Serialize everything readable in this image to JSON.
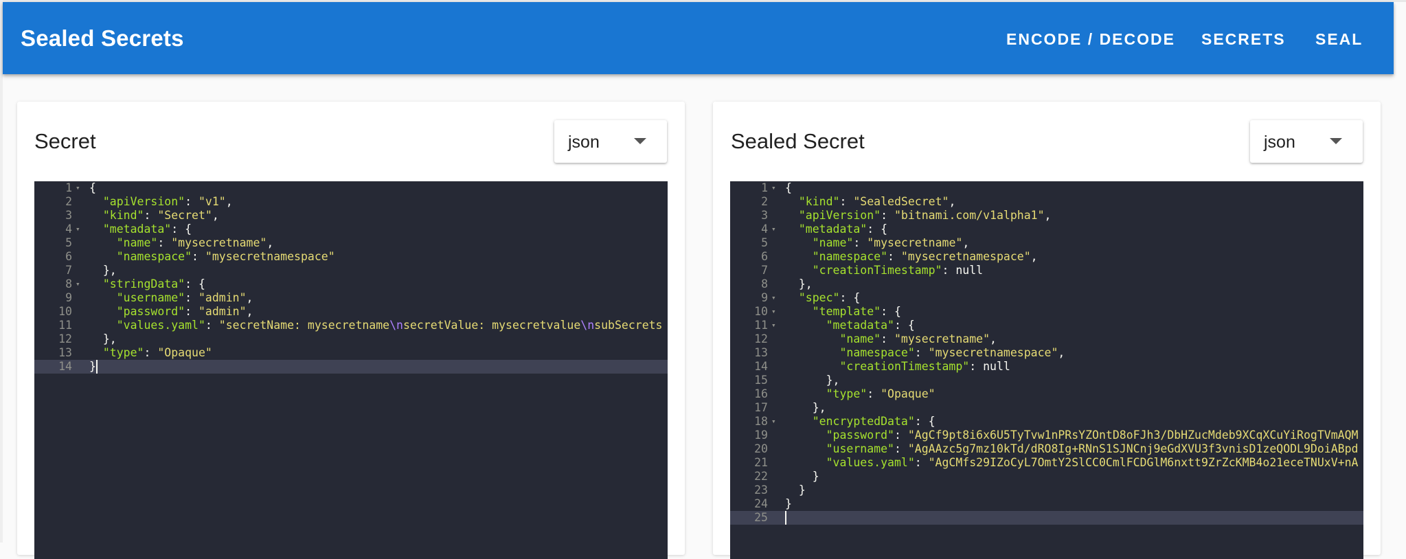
{
  "app": {
    "title": "Sealed Secrets"
  },
  "nav": [
    {
      "label": "ENCODE / DECODE"
    },
    {
      "label": "SECRETS"
    },
    {
      "label": "SEAL"
    }
  ],
  "left_panel": {
    "title": "Secret",
    "format": "json",
    "lines": [
      {
        "n": "1",
        "t": "{"
      },
      {
        "n": "2",
        "t": "  \"apiVersion\": \"v1\","
      },
      {
        "n": "3",
        "t": "  \"kind\": \"Secret\","
      },
      {
        "n": "4",
        "t": "  \"metadata\": {"
      },
      {
        "n": "5",
        "t": "    \"name\": \"mysecretname\","
      },
      {
        "n": "6",
        "t": "    \"namespace\": \"mysecretnamespace\""
      },
      {
        "n": "7",
        "t": "  },"
      },
      {
        "n": "8",
        "t": "  \"stringData\": {"
      },
      {
        "n": "9",
        "t": "    \"username\": \"admin\","
      },
      {
        "n": "10",
        "t": "    \"password\": \"admin\","
      },
      {
        "n": "11",
        "t": "    \"values.yaml\": \"secretName: mysecretname\\nsecretValue: mysecretvalue\\nsubSecrets"
      },
      {
        "n": "12",
        "t": "  },"
      },
      {
        "n": "13",
        "t": "  \"type\": \"Opaque\""
      },
      {
        "n": "14",
        "t": "}"
      }
    ]
  },
  "right_panel": {
    "title": "Sealed Secret",
    "format": "json",
    "lines": [
      {
        "n": "1",
        "t": "{"
      },
      {
        "n": "2",
        "t": "  \"kind\": \"SealedSecret\","
      },
      {
        "n": "3",
        "t": "  \"apiVersion\": \"bitnami.com/v1alpha1\","
      },
      {
        "n": "4",
        "t": "  \"metadata\": {"
      },
      {
        "n": "5",
        "t": "    \"name\": \"mysecretname\","
      },
      {
        "n": "6",
        "t": "    \"namespace\": \"mysecretnamespace\","
      },
      {
        "n": "7",
        "t": "    \"creationTimestamp\": null"
      },
      {
        "n": "8",
        "t": "  },"
      },
      {
        "n": "9",
        "t": "  \"spec\": {"
      },
      {
        "n": "10",
        "t": "    \"template\": {"
      },
      {
        "n": "11",
        "t": "      \"metadata\": {"
      },
      {
        "n": "12",
        "t": "        \"name\": \"mysecretname\","
      },
      {
        "n": "13",
        "t": "        \"namespace\": \"mysecretnamespace\","
      },
      {
        "n": "14",
        "t": "        \"creationTimestamp\": null"
      },
      {
        "n": "15",
        "t": "      },"
      },
      {
        "n": "16",
        "t": "      \"type\": \"Opaque\""
      },
      {
        "n": "17",
        "t": "    },"
      },
      {
        "n": "18",
        "t": "    \"encryptedData\": {"
      },
      {
        "n": "19",
        "t": "      \"password\": \"AgCf9pt8i6x6U5TyTvw1nPRsYZOntD8oFJh3/DbHZucMdeb9XCqXCuYiRogTVmAQM"
      },
      {
        "n": "20",
        "t": "      \"username\": \"AgAAzc5g7mz10kTd/dRO8Ig+RNnS1SJNCnj9eGdXVU3f3vnisD1zeQODL9DoiABpd"
      },
      {
        "n": "21",
        "t": "      \"values.yaml\": \"AgCMfs29IZoCyL7OmtY2SlCC0CmlFCDGlM6nxtt9ZrZcKMB4o21eceTNUxV+nA"
      },
      {
        "n": "22",
        "t": "    }"
      },
      {
        "n": "23",
        "t": "  }"
      },
      {
        "n": "24",
        "t": "}"
      },
      {
        "n": "25",
        "t": ""
      }
    ]
  },
  "colors": {
    "appbar": "#1976d2",
    "editor_bg": "#262935",
    "key": "#a6e22e",
    "string": "#e6db74",
    "escape": "#ae81ff"
  }
}
